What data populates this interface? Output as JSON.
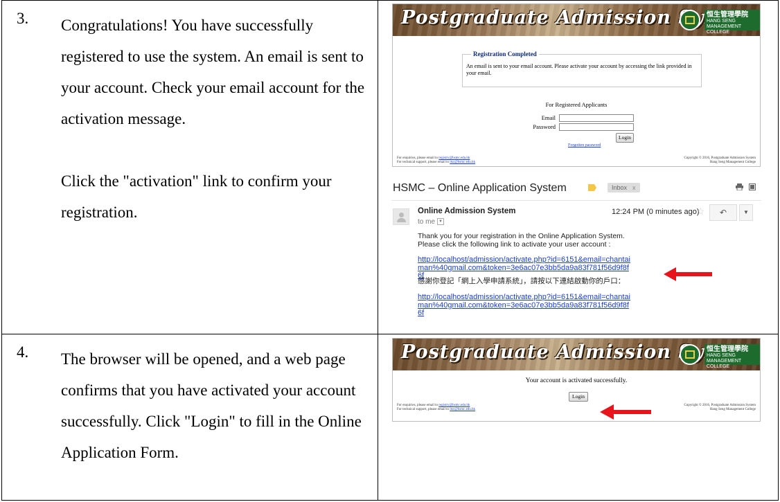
{
  "steps": [
    {
      "number": "3.",
      "paragraphs": [
        "Congratulations!   You have successfully registered to use the system.   An email is sent to your account.   Check your email account for the activation message.",
        "Click the \"activation\" link to confirm your registration."
      ]
    },
    {
      "number": "4.",
      "paragraphs": [
        "The browser will be opened, and a web page confirms that you have activated your account successfully.   Click \"Login\" to fill in the Online Application Form."
      ]
    }
  ],
  "banner": {
    "title": "Postgraduate Admission System",
    "logo_chinese": "恒生管理學院",
    "logo_english_1": "HANG SENG",
    "logo_english_2": "MANAGEMENT COLLEGE"
  },
  "registration_page": {
    "box_title": "Registration Completed",
    "box_message": "An email is sent to your email account. Please activate your account by accessing the link provided in your email.",
    "section_heading": "For Registered Applicants",
    "email_label": "Email",
    "password_label": "Password",
    "login_button": "Login",
    "forgotten_link": "Forgotten password"
  },
  "footer": {
    "enquiries_text": "For enquiries, please email to ",
    "enquiries_email": "registry@hsmc.edu.hk",
    "support_text": "For technical support, please email to ",
    "support_email": "itsc@hsmc.edu.hk",
    "copyright": "Copyright © 2016, Postgraduate Admission System",
    "college": "Hang Seng Management College"
  },
  "email": {
    "subject": "HSMC – Online Application System",
    "inbox_label": "Inbox",
    "inbox_close": "x",
    "sender": "Online Admission System",
    "to_me": "to me",
    "time": "12:24 PM (0 minutes ago)",
    "body_line1": "Thank you for your registration in the Online Application System.",
    "body_line2": "Please click the following link to activate your user account :",
    "activation_link": "http://localhost/admission/activate.php?id=6151&email=chantaiman%40gmail.com&token=3e6ac07e3bb5da9a83f781f56d9f8f6f",
    "chinese_line": "感謝你登記「網上入學申請系統」，請按以下連結啟動你的戶口：",
    "activation_link_2": "http://localhost/admission/activate.php?id=6151&email=chantaiman%40gmail.com&token=3e6ac07e3bb5da9a83f781f56d9f8f6f"
  },
  "activated_page": {
    "message": "Your account is activated successfully.",
    "login_button": "Login"
  },
  "colors": {
    "arrow": "#e8141b",
    "link": "#1a3fcf",
    "box_title": "#0d2a7a"
  },
  "icons": [
    "print-icon",
    "new-window-icon",
    "star-icon",
    "reply-icon",
    "more-dropdown-icon",
    "label-icon",
    "avatar-icon",
    "red-arrow-icon"
  ]
}
